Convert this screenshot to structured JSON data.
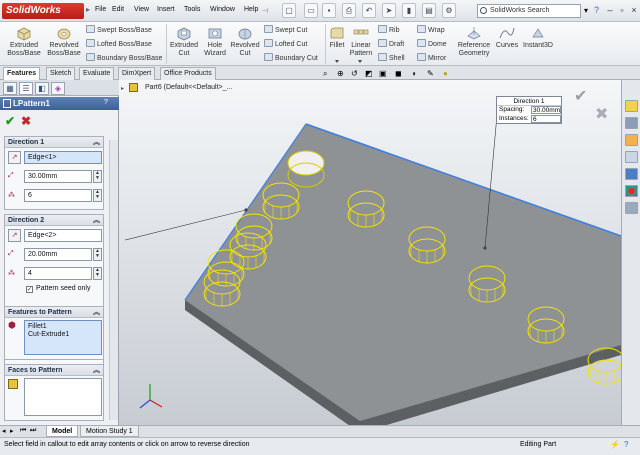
{
  "app": {
    "logo_text": "SolidWorks",
    "menus": [
      "File",
      "Edit",
      "View",
      "Insert",
      "Tools",
      "Window",
      "Help"
    ],
    "search_placeholder": "SolidWorks Search"
  },
  "ribbon": {
    "extruded_boss": "Extruded Boss/Base",
    "revolved_boss": "Revolved Boss/Base",
    "swept_boss": "Swept Boss/Base",
    "lofted_boss": "Lofted Boss/Base",
    "boundary_boss": "Boundary Boss/Base",
    "extruded_cut": "Extruded Cut",
    "hole_wizard": "Hole Wizard",
    "revolved_cut": "Revolved Cut",
    "swept_cut": "Swept Cut",
    "lofted_cut": "Lofted Cut",
    "boundary_cut": "Boundary Cut",
    "fillet": "Fillet",
    "linear_pattern": "Linear Pattern",
    "rib": "Rib",
    "draft": "Draft",
    "shell": "Shell",
    "wrap": "Wrap",
    "dome": "Dome",
    "mirror": "Mirror",
    "reference_geometry": "Reference Geometry",
    "curves": "Curves",
    "instant3d": "Instant3D"
  },
  "command_tabs": [
    "Features",
    "Sketch",
    "Evaluate",
    "DimXpert",
    "Office Products"
  ],
  "property_manager": {
    "title": "LPattern1",
    "direction1": {
      "header": "Direction 1",
      "edge": "Edge<1>",
      "spacing": "30.00mm",
      "instances": "6"
    },
    "direction2": {
      "header": "Direction 2",
      "edge": "Edge<2>",
      "spacing": "20.00mm",
      "instances": "4",
      "seed_only_label": "Pattern seed only",
      "seed_only_check": "✓"
    },
    "features": {
      "header": "Features to Pattern",
      "items": [
        "Fillet1",
        "Cut-Extrude1"
      ]
    },
    "faces": {
      "header": "Faces to Pattern"
    }
  },
  "tree": {
    "part": "Part6  (Default<<Default>_..."
  },
  "callout": {
    "title": "Direction 1",
    "spacing_label": "Spacing:",
    "spacing_value": "30.00mm",
    "instances_label": "Instances:",
    "instances_value": "6"
  },
  "bottom_tabs": [
    "Model",
    "Motion Study 1"
  ],
  "status": {
    "message": "Select field in callout to edit array contents or click on arrow to reverse direction",
    "mode": "Editing Part"
  },
  "colors": {
    "accent": "#3b6098",
    "pattern_outline": "#f4e400",
    "edge_highlight": "#3f7fe0",
    "part_face": "#8f9294"
  }
}
